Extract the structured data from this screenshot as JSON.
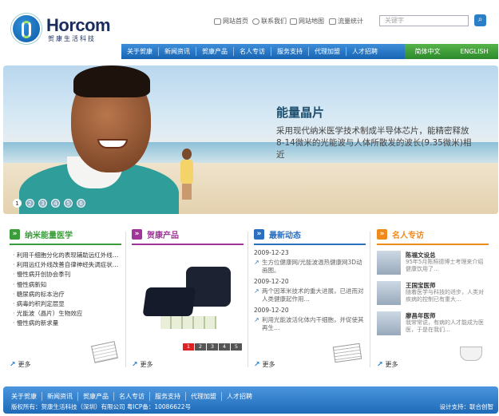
{
  "logo": {
    "name": "Horcom",
    "sub": "贺康生活科技"
  },
  "toplinks": [
    "网站首页",
    "联系我们",
    "网站地图",
    "流量统计"
  ],
  "search": {
    "placeholder": "关键字"
  },
  "nav": [
    "关于贺康",
    "新闻资讯",
    "贺康产品",
    "名人专访",
    "服务支持",
    "代理加盟",
    "人才招聘"
  ],
  "lang": [
    "简体中文",
    "ENGLISH"
  ],
  "banner": {
    "title": "能量晶片",
    "desc": "采用现代纳米医学技术制成半导体芯片，能精密释放8-14微米的光能波与人体所散发的波长(9.35微米)相近",
    "dots": [
      "1",
      "2",
      "3",
      "4",
      "5",
      "6"
    ],
    "active": "1"
  },
  "col1": {
    "title": "纳米能量医学",
    "color": "#3a9d3a",
    "items": [
      "利用千细胞分化的表现辅助远红外线…",
      "利用远红外线改善自律神经失调症状…",
      "慢性病开创协会季刊",
      "慢性病新知",
      "糖尿病的标本治疗",
      "病毒的积判定层显",
      "光能波（晶片）生物效应",
      "慢性病的新求量"
    ]
  },
  "col2": {
    "title": "贺康产品",
    "color": "#a0349a",
    "tags": [
      "1",
      "2",
      "3",
      "4",
      "5"
    ]
  },
  "col3": {
    "title": "最新动态",
    "color": "#2a6fc0",
    "news": [
      {
        "date": "2009-12-23",
        "text": "生方位健康网/光能波温热健康网3D动画图。"
      },
      {
        "date": "2009-12-20",
        "text": "两个因苯米技术的重大进展，已进而对人类健康起作用…"
      },
      {
        "date": "2009-12-20",
        "text": "利用光能波活化体内干细胞，并促使其再生…"
      }
    ]
  },
  "col4": {
    "title": "名人专访",
    "color": "#f08a1a",
    "docs": [
      {
        "name": "陈福文设总",
        "desc": "95年5月陈照德博士考理来介绍健康饮用了…"
      },
      {
        "name": "王国宝医师",
        "desc": "随着医学与科技的进步，人类对疾病的控制已有重大…"
      },
      {
        "name": "廖昌年医师",
        "desc": "我常常说，有病的人才能成为医医，于是在我们…"
      }
    ]
  },
  "more": "更多",
  "footer": {
    "links": [
      "关于贺康",
      "新闻资讯",
      "贺康产品",
      "名人专访",
      "服务支持",
      "代理加盟",
      "人才招聘"
    ],
    "copyright": "版权所有：贺康生活科技（深圳）有限公司    粤ICP备：10086622号",
    "design": "设计支持：联合创智"
  }
}
